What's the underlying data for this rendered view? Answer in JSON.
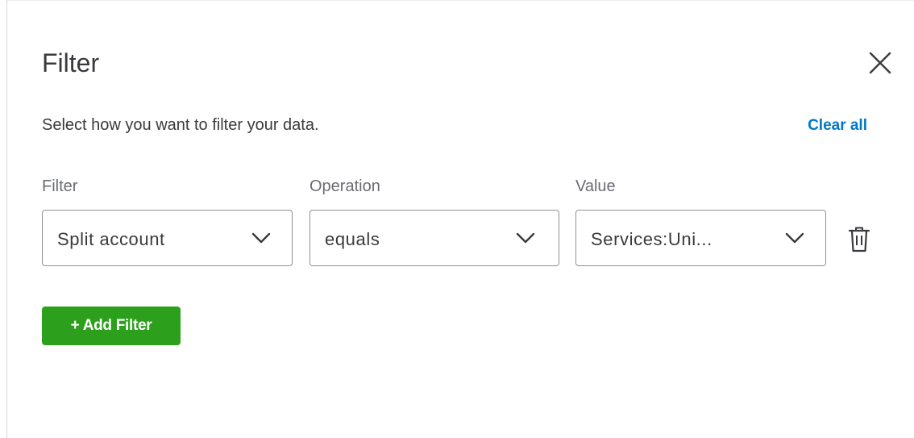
{
  "panel": {
    "title": "Filter",
    "subtitle": "Select how you want to filter your data.",
    "clear_all_label": "Clear all"
  },
  "columns": {
    "filter_label": "Filter",
    "operation_label": "Operation",
    "value_label": "Value"
  },
  "filter_row": {
    "filter_value": "Split account",
    "operation_value": "equals",
    "value_value": "Services:Uni..."
  },
  "actions": {
    "add_filter_label": "+ Add Filter"
  },
  "icons": {
    "close": "close-icon",
    "chevron": "chevron-down-icon",
    "delete": "trash-icon"
  },
  "colors": {
    "text": "#393a3d",
    "label": "#6b6c72",
    "link": "#0077c5",
    "primary_button": "#2ca01c",
    "border": "#8d9096"
  }
}
